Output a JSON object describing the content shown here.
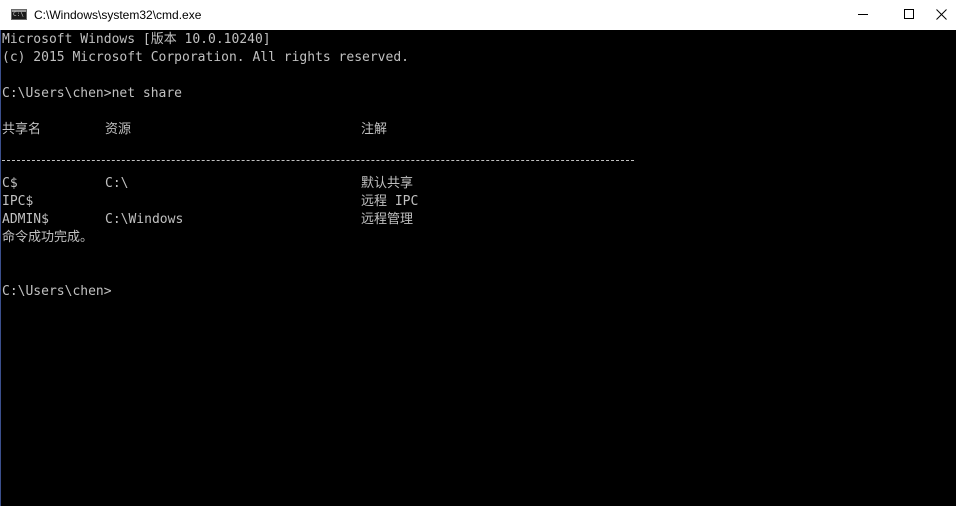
{
  "window": {
    "title": "C:\\Windows\\system32\\cmd.exe",
    "icon": "cmd-icon",
    "controls": [
      "minimize-icon",
      "maximize-icon",
      "close-icon"
    ]
  },
  "console": {
    "header_line1": "Microsoft Windows [版本 10.0.10240]",
    "header_line2": "(c) 2015 Microsoft Corporation. All rights reserved.",
    "command_prompt": "C:\\Users\\chen>net share",
    "table_headers": {
      "share_name": "共享名",
      "resource": "资源",
      "remark": "注解"
    },
    "shares": [
      {
        "name": "C$",
        "resource": "C:\\",
        "remark": "默认共享"
      },
      {
        "name": "IPC$",
        "resource": "",
        "remark": "远程 IPC"
      },
      {
        "name": "ADMIN$",
        "resource": "C:\\Windows",
        "remark": "远程管理"
      }
    ],
    "result": "命令成功完成。",
    "final_prompt": "C:\\Users\\chen>"
  },
  "colors": {
    "console_background": "#000000",
    "console_text": "#c0c0c0",
    "titlebar_background": "#ffffff"
  }
}
